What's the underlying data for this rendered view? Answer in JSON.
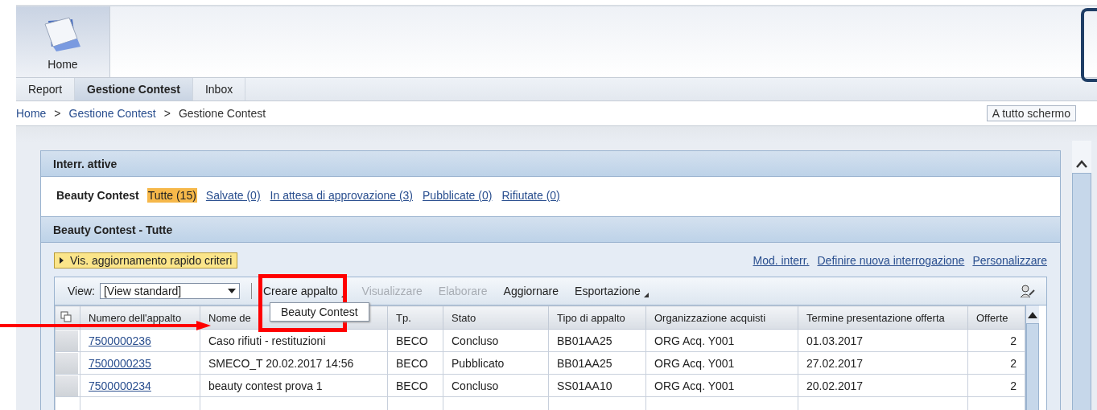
{
  "home_tile": {
    "label": "Home"
  },
  "tabs": [
    {
      "label": "Report",
      "selected": false
    },
    {
      "label": "Gestione Contest",
      "selected": true
    },
    {
      "label": "Inbox",
      "selected": false
    }
  ],
  "breadcrumb": [
    {
      "label": "Home",
      "kind": "link"
    },
    {
      "label": "Gestione Contest",
      "kind": "link"
    },
    {
      "label": "Gestione Contest",
      "kind": "current"
    }
  ],
  "breadcrumb_separator": ">",
  "fullscreen_button": "A tutto schermo",
  "active_queries": {
    "title": "Interr. attive",
    "category": "Beauty Contest",
    "filters": [
      {
        "label": "Tutte (15)",
        "selected": true
      },
      {
        "label": "Salvate (0)",
        "selected": false
      },
      {
        "label": "In attesa di approvazione (3)",
        "selected": false
      },
      {
        "label": "Pubblicate (0)",
        "selected": false
      },
      {
        "label": "Rifiutate (0)",
        "selected": false
      }
    ]
  },
  "results": {
    "title": "Beauty Contest - Tutte",
    "criteria_toggle": "Vis. aggiornamento rapido criteri",
    "links": [
      "Mod. interr.",
      "Definire nuova interrogazione",
      "Personalizzare"
    ],
    "view_label": "View:",
    "view_value": "[View standard]",
    "toolbar": [
      {
        "label": "Creare appalto",
        "menu": true,
        "disabled": false
      },
      {
        "label": "Visualizzare",
        "menu": false,
        "disabled": true
      },
      {
        "label": "Elaborare",
        "menu": false,
        "disabled": true
      },
      {
        "label": "Aggiornare",
        "menu": false,
        "disabled": false
      },
      {
        "label": "Esportazione",
        "menu": true,
        "disabled": false
      }
    ],
    "open_menu": [
      "Beauty Contest"
    ],
    "table": {
      "columns": [
        "Numero dell'appalto",
        "Nome de",
        "Tp.",
        "Stato",
        "Tipo di appalto",
        "Organizzazione acquisti",
        "Termine presentazione offerta",
        "Offerte"
      ],
      "rows": [
        [
          "7500000236",
          "Caso rifiuti - restituzioni",
          "BECO",
          "Concluso",
          "BB01AA25",
          "ORG Acq. Y001",
          "01.03.2017",
          "2"
        ],
        [
          "7500000235",
          "SMECO_T 20.02.2017 14:56",
          "BECO",
          "Pubblicato",
          "BB01AA25",
          "ORG Acq. Y001",
          "27.02.2017",
          "2"
        ],
        [
          "7500000234",
          "beauty contest prova 1",
          "BECO",
          "Concluso",
          "SS01AA10",
          "ORG Acq. Y001",
          "20.02.2017",
          "2"
        ]
      ]
    }
  }
}
